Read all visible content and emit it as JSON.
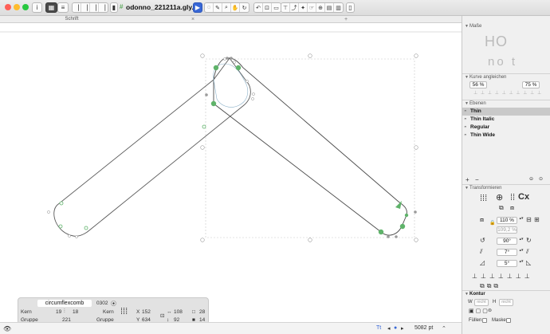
{
  "toolbar": {
    "info_label": "i",
    "doc_icon": "#",
    "doc_title": "odonno_221211a.gly...",
    "traffic_colors": [
      "#ff5f57",
      "#febc2e",
      "#28c840"
    ],
    "tools": [
      "select-arrow-icon",
      "select-lasso-icon",
      "pen-icon",
      "zoom-icon",
      "hand-icon",
      "rotate-icon",
      "knife-icon",
      "annotate-icon",
      "rectangle-icon",
      "ellipse-icon",
      "brush-icon",
      "text-icon",
      "component-icon",
      "measure-icon",
      "smooth-icon",
      "more-icon"
    ],
    "accent": "#3867d6"
  },
  "tabs": {
    "active_label": "Schrift",
    "plus_label": "+"
  },
  "glyph": {
    "outline_color": "#555555",
    "node_color": "#5fb36a",
    "handle_color": "#9a9a9a"
  },
  "infobox": {
    "glyph_name": "circumflexcomb",
    "unicode": "0302",
    "kern_label": "Kern",
    "group_label": "Gruppe",
    "kern_left": "19",
    "kern_right": "18",
    "group_value": "221",
    "kern_label2": "Kern",
    "group_label2": "Gruppe",
    "x_label": "X",
    "x_value": "152",
    "y_label": "Y",
    "y_value": "634",
    "width_value": "108",
    "height_value": "92",
    "count_top": "28",
    "count_bottom": "14"
  },
  "status": {
    "zoom_value": "5082 pt"
  },
  "panel": {
    "masse_label": "Maße",
    "masse_preview_top": "HO",
    "masse_preview_bottom": "no t",
    "kurve_label": "Kurve angleichen",
    "kurve_left": "56 %",
    "kurve_right": "75 %",
    "ebenen_label": "Ebenen",
    "layers": [
      {
        "label": "Thin",
        "selected": true
      },
      {
        "label": "Thin Italic",
        "selected": false
      },
      {
        "label": "Regular",
        "selected": false
      },
      {
        "label": "Thin Wide",
        "selected": false
      }
    ],
    "layer_add": "+",
    "layer_remove": "−",
    "transform_label": "Transformieren",
    "transform_cx": "Cx",
    "scale_value": "110 %",
    "scale_value2": "109,2 %",
    "rotate_value": "90°",
    "slant_value": "7°",
    "skew_value": "5°",
    "kontur_label": "Kontur",
    "w_label": "W",
    "w_placeholder": "nicht",
    "h_label": "H",
    "h_placeholder": "nicht",
    "fill_label": "Füllen",
    "mask_label": "Maske"
  }
}
